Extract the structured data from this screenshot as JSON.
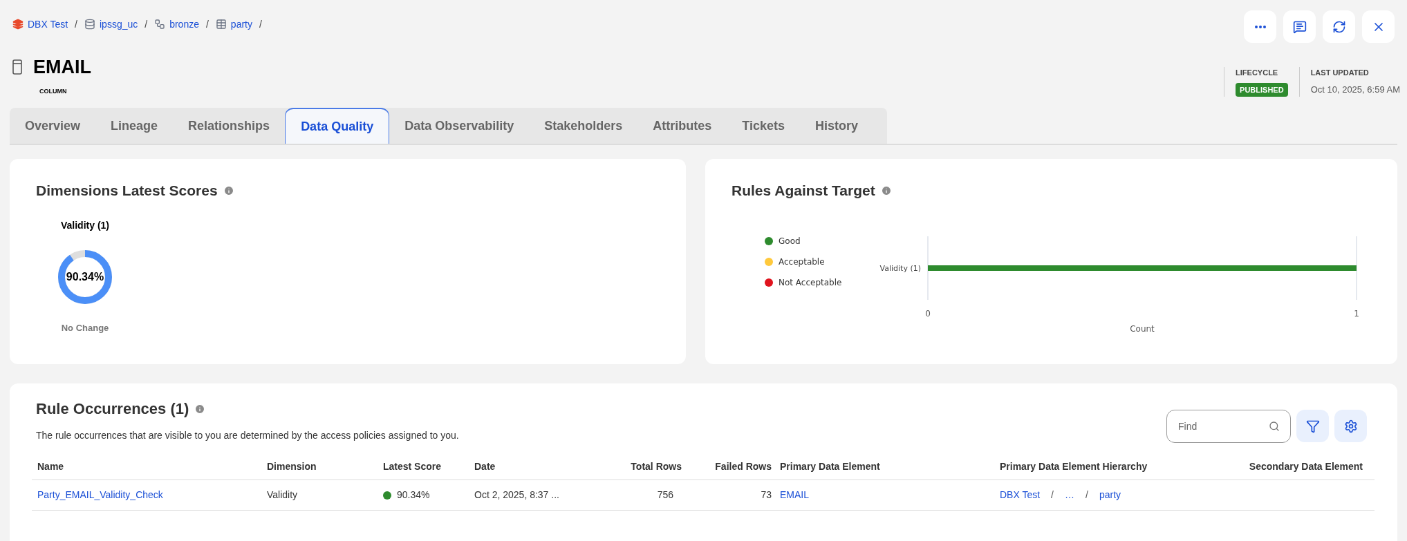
{
  "breadcrumb": {
    "separator": "/",
    "items": [
      {
        "label": "DBX Test",
        "kind": "catalog"
      },
      {
        "label": "ipssg_uc",
        "kind": "database"
      },
      {
        "label": "bronze",
        "kind": "schema"
      },
      {
        "label": "party",
        "kind": "table"
      }
    ]
  },
  "header_actions": [
    {
      "kind": "more"
    },
    {
      "kind": "comment"
    },
    {
      "kind": "refresh"
    },
    {
      "kind": "close"
    }
  ],
  "asset": {
    "title": "EMAIL",
    "type": "COLUMN"
  },
  "lifecycle": {
    "label": "LIFECYCLE",
    "status": "PUBLISHED"
  },
  "last_updated": {
    "label": "LAST UPDATED",
    "value": "Oct 10, 2025, 6:59 AM"
  },
  "tabs": [
    {
      "label": "Overview",
      "selected": false
    },
    {
      "label": "Lineage",
      "selected": false
    },
    {
      "label": "Relationships",
      "selected": false
    },
    {
      "label": "Data Quality",
      "selected": true
    },
    {
      "label": "Data Observability",
      "selected": false
    },
    {
      "label": "Stakeholders",
      "selected": false
    },
    {
      "label": "Attributes",
      "selected": false
    },
    {
      "label": "Tickets",
      "selected": false
    },
    {
      "label": "History",
      "selected": false
    }
  ],
  "dimensions_card": {
    "title": "Dimensions Latest Scores",
    "scores": [
      {
        "name": "Validity (1)",
        "value": "90.34%",
        "level": 0.9034,
        "change": "No Change"
      }
    ]
  },
  "rules_card": {
    "title": "Rules Against Target",
    "chart_data": {
      "type": "bar",
      "categories": [
        "Validity (1)"
      ],
      "orientation": "horizontal",
      "xlabel": "Count",
      "xticks": [
        {
          "value": 0,
          "label": "0"
        },
        {
          "value": 1,
          "label": "1"
        }
      ],
      "xlim": [
        0,
        1
      ],
      "series": [
        {
          "name": "Good",
          "color": "#2e8b2e",
          "values": [
            1
          ]
        },
        {
          "name": "Acceptable",
          "color": "#ffc93c",
          "values": [
            0
          ]
        },
        {
          "name": "Not Acceptable",
          "color": "#e0141e",
          "values": [
            0
          ]
        }
      ]
    }
  },
  "occurrences": {
    "title": "Rule Occurrences (1)",
    "description": "The rule occurrences that are visible to you are determined by the access policies assigned to you.",
    "search": {
      "placeholder": "Find"
    },
    "columns": [
      "Name",
      "Dimension",
      "Latest Score",
      "Date",
      "Total Rows",
      "Failed Rows",
      "Primary Data Element",
      "Primary Data Element Hierarchy",
      "Secondary Data Element"
    ],
    "rows": [
      {
        "name": "Party_EMAIL_Validity_Check",
        "dimension": "Validity",
        "score": "90.34%",
        "color": "#2e8b2e",
        "date": "Oct 2, 2025, 8:37 ...",
        "total_rows": "756",
        "failed_rows": "73",
        "primary_element": "EMAIL",
        "hierarchy": {
          "separator": "/",
          "items": [
            "DBX Test",
            "…",
            "party"
          ]
        }
      }
    ]
  }
}
